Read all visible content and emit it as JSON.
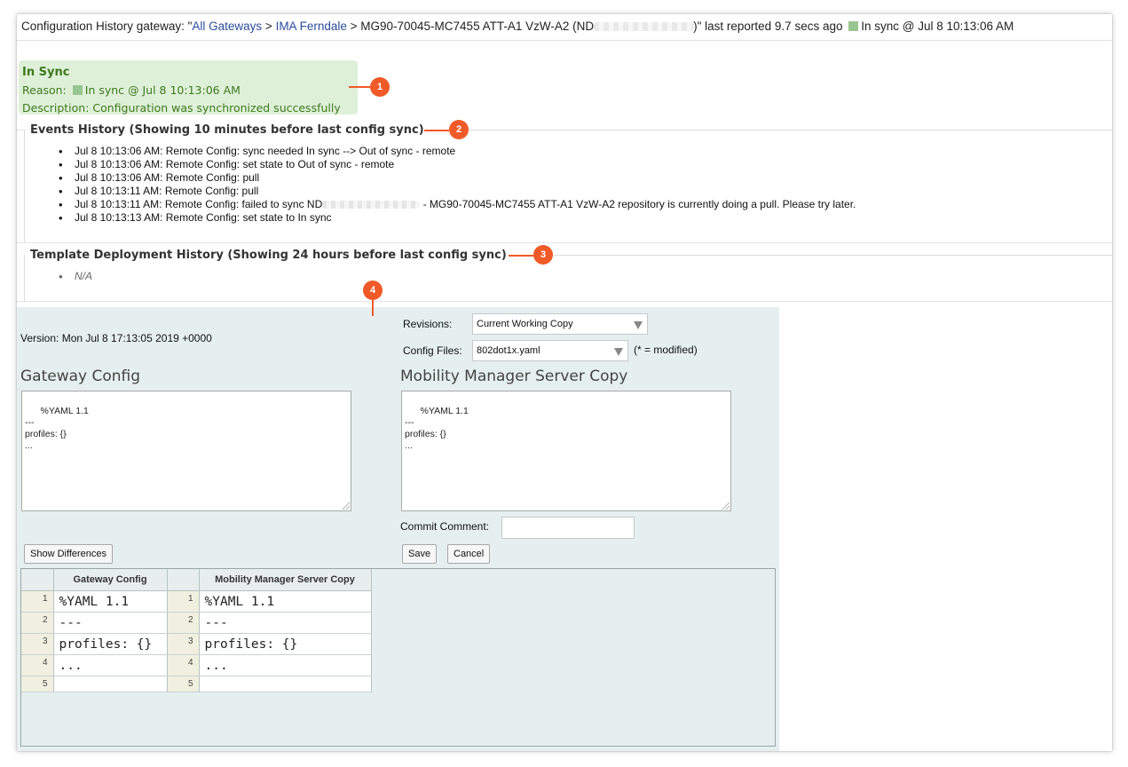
{
  "header": {
    "prefix": "Configuration History gateway: \"",
    "link_all": "All Gateways",
    "sep1": " > ",
    "link_site": "IMA Ferndale",
    "sep2": " > ",
    "device": "MG90-70045-MC7455 ATT-A1 VzW-A2 (ND",
    "suffix": ")\" last reported 9.7 secs ago",
    "status": "In sync @ Jul 8 10:13:06 AM",
    "status_color": "#98c690"
  },
  "sync": {
    "title": "In Sync",
    "reason_label": "Reason:",
    "reason_value": "In sync @ Jul 8 10:13:06 AM",
    "description": "Description: Configuration was synchronized successfully",
    "bg_color": "#dff0d8"
  },
  "callouts": [
    "1",
    "2",
    "3",
    "4"
  ],
  "events": {
    "title": "Events History (Showing 10 minutes before last config sync)",
    "items": [
      "Jul 8 10:13:06 AM: Remote Config: sync needed In sync --> Out of sync - remote",
      "Jul 8 10:13:06 AM: Remote Config: set state to Out of sync - remote",
      "Jul 8 10:13:06 AM: Remote Config: pull",
      "Jul 8 10:13:11 AM: Remote Config: pull",
      "Jul 8 10:13:13 AM: Remote Config: set state to In sync"
    ],
    "failed_prefix": "Jul 8 10:13:11 AM: Remote Config: failed to sync ND",
    "failed_suffix": " - MG90-70045-MC7455 ATT-A1 VzW-A2 repository is currently doing a pull. Please try later."
  },
  "templates": {
    "title": "Template Deployment History (Showing 24 hours before last config sync)",
    "items": [
      "N/A"
    ]
  },
  "editor": {
    "version": "Version: Mon Jul 8 17:13:05 2019 +0000",
    "revisions_label": "Revisions:",
    "revisions_value": "Current Working Copy",
    "config_files_label": "Config Files:",
    "config_files_value": "802dot1x.yaml",
    "modified_note": "(* = modified)",
    "gateway_title": "Gateway Config",
    "gateway_text": "%YAML 1.1\n---\nprofiles: {}\n...",
    "server_title": "Mobility Manager Server Copy",
    "server_text": "%YAML 1.1\n---\nprofiles: {}\n...",
    "commit_label": "Commit Comment:",
    "commit_value": "",
    "show_diff": "Show Differences",
    "save": "Save",
    "cancel": "Cancel"
  },
  "diff": {
    "left_header": "Gateway Config",
    "right_header": "Mobility Manager Server Copy",
    "rows": [
      {
        "ln": "1",
        "left": "%YAML 1.1",
        "right": "%YAML 1.1"
      },
      {
        "ln": "2",
        "left": "---",
        "right": "---"
      },
      {
        "ln": "3",
        "left": "profiles: {}",
        "right": "profiles: {}"
      },
      {
        "ln": "4",
        "left": "...",
        "right": "..."
      },
      {
        "ln": "5",
        "left": "",
        "right": ""
      }
    ]
  }
}
